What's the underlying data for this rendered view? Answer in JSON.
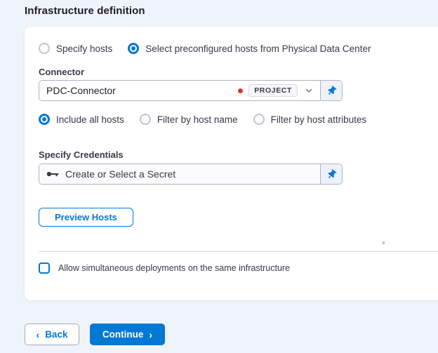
{
  "page": {
    "title": "Infrastructure definition"
  },
  "host_mode": {
    "options": [
      {
        "label": "Specify hosts",
        "selected": false
      },
      {
        "label": "Select preconfigured hosts from Physical Data Center",
        "selected": true
      }
    ]
  },
  "connector": {
    "label": "Connector",
    "value": "PDC-Connector",
    "scope_badge": "PROJECT",
    "has_error_dot": true
  },
  "host_filter": {
    "options": [
      {
        "label": "Include all hosts",
        "selected": true
      },
      {
        "label": "Filter by host name",
        "selected": false
      },
      {
        "label": "Filter by host attributes",
        "selected": false
      }
    ]
  },
  "credentials": {
    "label": "Specify Credentials",
    "placeholder": "Create or Select a Secret"
  },
  "simultaneous_deployments": {
    "label": "Allow simultaneous deployments on the same infrastructure",
    "checked": false
  },
  "actions": {
    "preview_hosts": "Preview Hosts",
    "back": "Back",
    "continue": "Continue"
  },
  "icons": {
    "back_chevron": "‹",
    "continue_chevron": "›",
    "pin": "pushpin-icon",
    "key": "key-icon",
    "chevron_down": "chevron-down-icon"
  },
  "colors": {
    "accent": "#0278d5",
    "error_dot": "#e43326",
    "page_bg": "#eff4fa",
    "card_bg": "#ffffff"
  }
}
